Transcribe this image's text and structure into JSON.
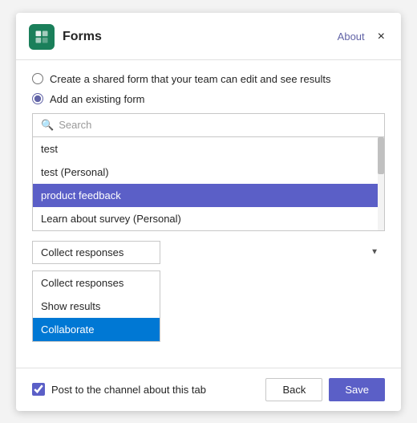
{
  "header": {
    "app_name": "Forms",
    "about_label": "About",
    "close_icon": "×"
  },
  "options": {
    "shared_form_label": "Create a shared form that your team can edit and see results",
    "existing_form_label": "Add an existing form"
  },
  "search": {
    "placeholder": "Search"
  },
  "form_list": {
    "items": [
      {
        "label": "test",
        "selected": false
      },
      {
        "label": "test (Personal)",
        "selected": false
      },
      {
        "label": "product feedback",
        "selected": true
      },
      {
        "label": "Learn about survey (Personal)",
        "selected": false
      }
    ]
  },
  "action_dropdown": {
    "selected_label": "Collect responses",
    "arrow": "▼"
  },
  "action_list": {
    "items": [
      {
        "label": "Collect responses",
        "selected": false
      },
      {
        "label": "Show results",
        "selected": false
      },
      {
        "label": "Collaborate",
        "selected": true
      }
    ]
  },
  "footer": {
    "post_label": "Post to the channel about this tab",
    "back_label": "Back",
    "save_label": "Save"
  }
}
